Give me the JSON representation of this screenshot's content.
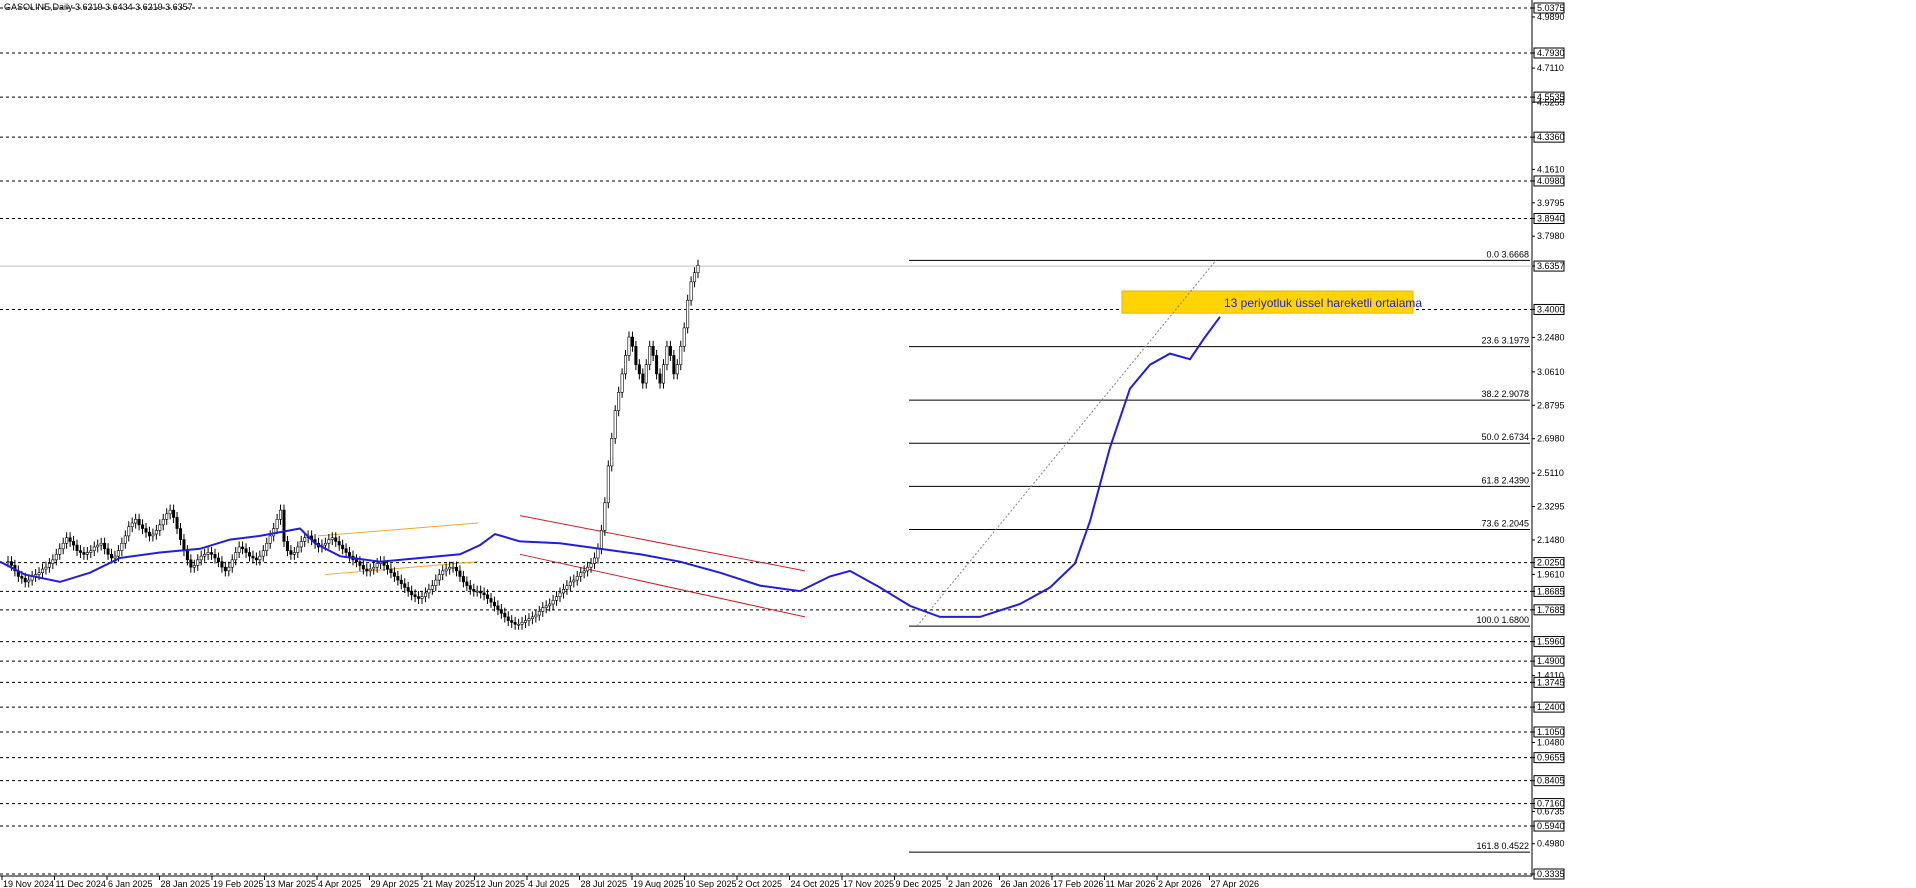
{
  "header": {
    "text": "GASOLINE,Daily  3.6219 3.6434 3.6219 3.6357"
  },
  "annotation": {
    "text": "13 periyotluk üssel hareketli ortalama"
  },
  "colors": {
    "background": "#ffffff",
    "candle": "#000000",
    "ema": "#1f1fdc",
    "channel_up": "#f5a623",
    "channel_down": "#d32020",
    "zone": "#ffd400",
    "grid": "#000000",
    "fib": "#000000"
  },
  "chart_data": {
    "type": "candlestick",
    "title": "GASOLINE,Daily",
    "ylim": [
      0.3335,
      5.0375
    ],
    "price_scale_ticks": [
      "5.0375",
      "4.9890",
      "4.7930",
      "4.7110",
      "4.5535",
      "4.5255",
      "4.3360",
      "4.1610",
      "4.0980",
      "3.9795",
      "3.8940",
      "3.7980",
      "3.6357",
      "3.4000",
      "3.2480",
      "3.0610",
      "2.8795",
      "2.6980",
      "2.5110",
      "2.3295",
      "2.1480",
      "2.0250",
      "1.9610",
      "1.8685",
      "1.7685",
      "1.5960",
      "1.4900",
      "1.4110",
      "1.3745",
      "1.2400",
      "1.1050",
      "1.0480",
      "0.9655",
      "0.8405",
      "0.7160",
      "0.6735",
      "0.5940",
      "0.4980",
      "0.3335"
    ],
    "boxed_ticks": [
      "5.0375",
      "4.7930",
      "4.5535",
      "4.3360",
      "4.0980",
      "3.8940",
      "3.6357",
      "3.4000",
      "2.0250",
      "1.8685",
      "1.7685",
      "1.5960",
      "1.4900",
      "1.3745",
      "1.2400",
      "1.1050",
      "0.9655",
      "0.8405",
      "0.7160",
      "0.5940",
      "0.3335"
    ],
    "dashed_levels": [
      5.0375,
      4.793,
      4.5535,
      4.336,
      4.098,
      3.894,
      3.4,
      2.025,
      1.8685,
      1.7685,
      1.596,
      1.49,
      1.3745,
      1.24,
      1.105,
      0.9655,
      0.8405,
      0.716,
      0.594,
      0.3335
    ],
    "current_price": 3.6357,
    "x_ticks": [
      "19 Nov 2024",
      "11 Dec 2024",
      "6 Jan 2025",
      "28 Jan 2025",
      "19 Feb 2025",
      "13 Mar 2025",
      "4 Apr 2025",
      "29 Apr 2025",
      "21 May 2025",
      "12 Jun 2025",
      "4 Jul 2025",
      "28 Jul 2025",
      "19 Aug 2025",
      "10 Sep 2025",
      "2 Oct 2025",
      "24 Oct 2025",
      "17 Nov 2025",
      "9 Dec 2025",
      "2 Jan 2026",
      "26 Jan 2026",
      "17 Feb 2026",
      "11 Mar 2026",
      "2 Apr 2026",
      "27 Apr 2026"
    ],
    "fibonacci": [
      {
        "label": "0.0 3.6668",
        "value": 3.6668
      },
      {
        "label": "23.6 3.1979",
        "value": 3.1979
      },
      {
        "label": "38.2 2.9078",
        "value": 2.9078
      },
      {
        "label": "50.0 2.6734",
        "value": 2.6734
      },
      {
        "label": "61.8 2.4390",
        "value": 2.439
      },
      {
        "label": "73.6 2.2045",
        "value": 2.2045
      },
      {
        "label": "100.0 1.6800",
        "value": 1.68
      },
      {
        "label": "161.8 0.4522",
        "value": 0.4522
      }
    ],
    "zone": [
      3.38,
      3.5
    ],
    "ema_path": [
      [
        0,
        2.03
      ],
      [
        25,
        1.96
      ],
      [
        60,
        1.92
      ],
      [
        90,
        1.97
      ],
      [
        120,
        2.05
      ],
      [
        160,
        2.08
      ],
      [
        200,
        2.1
      ],
      [
        230,
        2.15
      ],
      [
        260,
        2.17
      ],
      [
        300,
        2.21
      ],
      [
        315,
        2.13
      ],
      [
        340,
        2.06
      ],
      [
        380,
        2.03
      ],
      [
        420,
        2.05
      ],
      [
        460,
        2.07
      ],
      [
        480,
        2.12
      ],
      [
        495,
        2.18
      ],
      [
        520,
        2.14
      ],
      [
        560,
        2.13
      ],
      [
        600,
        2.1
      ],
      [
        640,
        2.07
      ],
      [
        680,
        2.03
      ],
      [
        720,
        1.97
      ],
      [
        760,
        1.9
      ],
      [
        800,
        1.87
      ],
      [
        830,
        1.95
      ],
      [
        850,
        1.98
      ],
      [
        880,
        1.89
      ],
      [
        910,
        1.79
      ],
      [
        940,
        1.73
      ],
      [
        980,
        1.73
      ],
      [
        1020,
        1.8
      ],
      [
        1050,
        1.89
      ],
      [
        1075,
        2.02
      ],
      [
        1090,
        2.25
      ],
      [
        1110,
        2.65
      ],
      [
        1130,
        2.97
      ],
      [
        1150,
        3.1
      ],
      [
        1170,
        3.16
      ],
      [
        1190,
        3.13
      ],
      [
        1205,
        3.25
      ],
      [
        1220,
        3.36
      ]
    ],
    "channels": {
      "up": [
        [
          [
            318,
            2.17
          ],
          [
            478,
            2.24
          ]
        ],
        [
          [
            325,
            1.96
          ],
          [
            478,
            2.03
          ]
        ]
      ],
      "down": [
        [
          [
            520,
            2.28
          ],
          [
            805,
            1.98
          ]
        ],
        [
          [
            520,
            2.07
          ],
          [
            805,
            1.73
          ]
        ]
      ]
    },
    "series": [
      {
        "name": "GASOLINE",
        "x0": 8,
        "dx": 3.45,
        "close": [
          2.03,
          2.01,
          1.98,
          1.95,
          1.94,
          1.92,
          1.93,
          1.95,
          1.96,
          1.97,
          1.99,
          2.0,
          2.02,
          2.04,
          2.07,
          2.1,
          2.13,
          2.16,
          2.14,
          2.12,
          2.09,
          2.08,
          2.07,
          2.08,
          2.09,
          2.11,
          2.12,
          2.13,
          2.1,
          2.07,
          2.05,
          2.06,
          2.09,
          2.13,
          2.17,
          2.22,
          2.24,
          2.26,
          2.23,
          2.21,
          2.19,
          2.17,
          2.18,
          2.2,
          2.23,
          2.26,
          2.29,
          2.31,
          2.27,
          2.21,
          2.15,
          2.09,
          2.04,
          2.0,
          2.01,
          2.04,
          2.06,
          2.07,
          2.08,
          2.07,
          2.05,
          2.03,
          2.0,
          1.98,
          2.0,
          2.04,
          2.08,
          2.11,
          2.1,
          2.08,
          2.06,
          2.05,
          2.04,
          2.06,
          2.09,
          2.13,
          2.17,
          2.21,
          2.26,
          2.31,
          2.14,
          2.09,
          2.07,
          2.08,
          2.11,
          2.14,
          2.16,
          2.17,
          2.15,
          2.13,
          2.11,
          2.12,
          2.13,
          2.15,
          2.16,
          2.14,
          2.12,
          2.1,
          2.08,
          2.06,
          2.04,
          2.03,
          2.01,
          1.99,
          1.98,
          1.99,
          2.0,
          2.02,
          2.03,
          2.01,
          1.99,
          1.97,
          1.95,
          1.93,
          1.91,
          1.89,
          1.87,
          1.85,
          1.84,
          1.83,
          1.84,
          1.86,
          1.88,
          1.9,
          1.93,
          1.96,
          1.98,
          1.99,
          2.0,
          2.0,
          1.98,
          1.95,
          1.92,
          1.9,
          1.88,
          1.87,
          1.87,
          1.86,
          1.85,
          1.83,
          1.81,
          1.79,
          1.77,
          1.75,
          1.73,
          1.71,
          1.7,
          1.69,
          1.69,
          1.7,
          1.71,
          1.72,
          1.73,
          1.74,
          1.76,
          1.78,
          1.79,
          1.8,
          1.82,
          1.84,
          1.86,
          1.88,
          1.9,
          1.92,
          1.93,
          1.95,
          1.97,
          1.98,
          2.0,
          2.02,
          2.05,
          2.1,
          2.2,
          2.35,
          2.55,
          2.7,
          2.85,
          2.95,
          3.05,
          3.15,
          3.25,
          3.2,
          3.1,
          3.05,
          3.0,
          3.1,
          3.2,
          3.15,
          3.05,
          3.0,
          3.1,
          3.2,
          3.15,
          3.05,
          3.1,
          3.2,
          3.3,
          3.45,
          3.55,
          3.6,
          3.64
        ]
      }
    ]
  }
}
